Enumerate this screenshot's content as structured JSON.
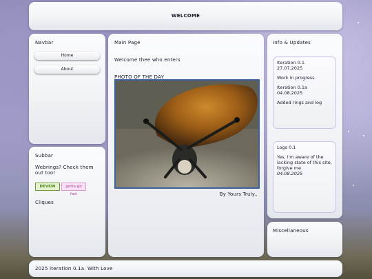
{
  "header": {
    "title": "WELCOME"
  },
  "navbar": {
    "title": "Navbar",
    "items": [
      {
        "label": "Home"
      },
      {
        "label": "About"
      }
    ]
  },
  "subbar": {
    "title": "Subbar",
    "webrings_text": "Webrings? Check them out too!",
    "badges": [
      {
        "label": "DEVEIN"
      },
      {
        "label": "gotta go fast"
      }
    ],
    "cliques_title": "Cliques"
  },
  "main": {
    "title": "Main Page",
    "welcome": "Welcome thee who enters",
    "photo_title": "PHOTO OF THE DAY",
    "photo_caption": "By Yours Truly.."
  },
  "updates": {
    "title": "Info & Updates",
    "entries": [
      {
        "text": "Iteration 0.1"
      },
      {
        "text": "27.07.2025"
      },
      {
        "text": "Work in progress"
      },
      {
        "text": "Iteration 0.1a"
      },
      {
        "text": "04.08.2025"
      },
      {
        "text": "Added rings and log"
      }
    ]
  },
  "logs": {
    "title": "Logs 0.1",
    "body": "Yes, i'm aware of the lacking state of this site, forgive me",
    "date": "04.08.2025"
  },
  "misc": {
    "title": "Miscellaneous"
  },
  "footer": {
    "text": "2025 Iteration 0.1a. With Love"
  },
  "colors": {
    "accent": "#3d5f9c",
    "box_border": "#c7c2e6"
  }
}
